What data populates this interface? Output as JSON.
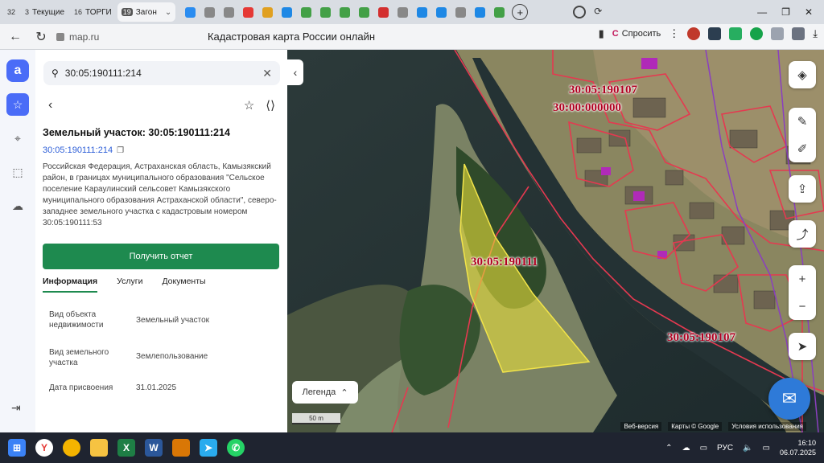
{
  "browser": {
    "tabs": [
      {
        "count": "32",
        "label": "",
        "favicon_color": "#555"
      },
      {
        "count": "3",
        "label": "Текущие",
        "favicon_color": "#555"
      },
      {
        "count": "16",
        "label": "ТОРГИ",
        "favicon_color": "#555"
      },
      {
        "count": "19",
        "label": "Загон",
        "favicon_color": "#555",
        "active": true
      }
    ],
    "icon_tabs": [
      "#2a8cf0",
      "#888",
      "#888",
      "#e53935",
      "#e0a020",
      "#1e88e5",
      "#43a047",
      "#43a047",
      "#43a047",
      "#43a047",
      "#d32f2f",
      "#888",
      "#1e88e5",
      "#1e88e5",
      "#888",
      "#1e88e5",
      "#43a047"
    ],
    "url": "map.ru",
    "page_title": "Кадастровая карта России онлайн",
    "ask_label": "Спросить"
  },
  "search": {
    "value": "30:05:190111:214"
  },
  "object": {
    "title": "Земельный участок: 30:05:190111:214",
    "cad_number": "30:05:190111:214",
    "address": "Российская Федерация, Астраханская область, Камызякский район, в границах муниципального образования \"Сельское поселение Караулинский сельсовет Камызякского муниципального образования Астраханской области\", северо-западнее земельного участка с кадастровым номером 30:05:190111:53",
    "report_button": "Получить отчет",
    "tabs": [
      "Информация",
      "Услуги",
      "Документы"
    ],
    "props": [
      {
        "key": "Вид объекта недвижимости",
        "value": "Земельный участок"
      },
      {
        "key": "Вид земельного участка",
        "value": "Землепользование"
      },
      {
        "key": "Дата присвоения",
        "value": "31.01.2025"
      }
    ]
  },
  "map": {
    "labels": [
      "30:05:190107",
      "30:00:000000",
      "30:05:190111",
      "30:05:190107"
    ],
    "legend_label": "Легенда",
    "scale_label": "50 m",
    "attribution": [
      "Веб-версия",
      "Карты © Google",
      "Условия использования"
    ]
  },
  "taskbar": {
    "lang": "РУС",
    "time": "16:10",
    "date": "06.07.2025"
  }
}
